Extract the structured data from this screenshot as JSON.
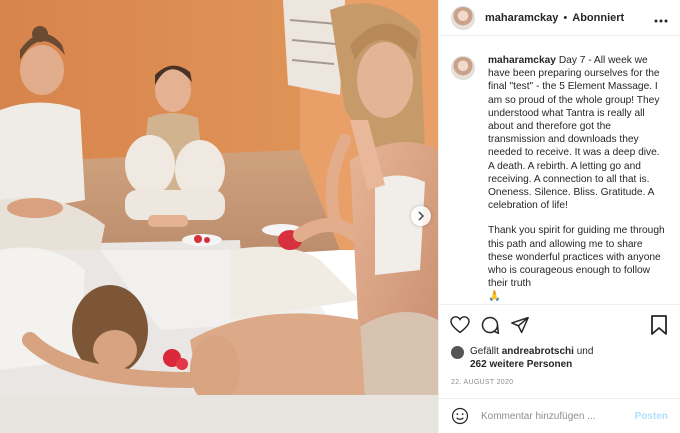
{
  "header": {
    "username": "maharamckay",
    "separator": "•",
    "follow_status": "Abonniert",
    "more_icon": "more-horizontal-icon"
  },
  "caption": {
    "username": "maharamckay",
    "paragraph1": "Day 7 - All week we have been preparing ourselves for the final \"test\" - the 5 Element Massage. I am so proud of the whole group! They understood what Tantra is really all about and therefore got the transmission and downloads they needed to receive. It was a deep dive. A death. A rebirth. A letting go and receiving. A connection to all that is. Oneness. Silence. Bliss. Gratitude. A celebration of life!",
    "paragraph2": "Thank you spirit for guiding me through this path and allowing me to share these wonderful practices with anyone who is courageous enough to follow their truth",
    "emoji": "🙏"
  },
  "actions": {
    "like_icon": "heart-icon",
    "comment_icon": "comment-icon",
    "share_icon": "share-icon",
    "save_icon": "bookmark-icon"
  },
  "likes": {
    "prefix": "Gefällt",
    "liker": "andreabrotschi",
    "connector": "und",
    "others": "262 weitere Personen"
  },
  "date": "22. AUGUST 2020",
  "comment": {
    "placeholder": "Kommentar hinzufügen ...",
    "post_label": "Posten",
    "emoji_icon": "smiley-icon"
  },
  "colors": {
    "text": "#262626",
    "muted": "#8e8e8e",
    "border": "#efefef",
    "post_button_disabled": "#b2dffc",
    "wall": "#d8864f",
    "floor": "#c79a7a"
  }
}
